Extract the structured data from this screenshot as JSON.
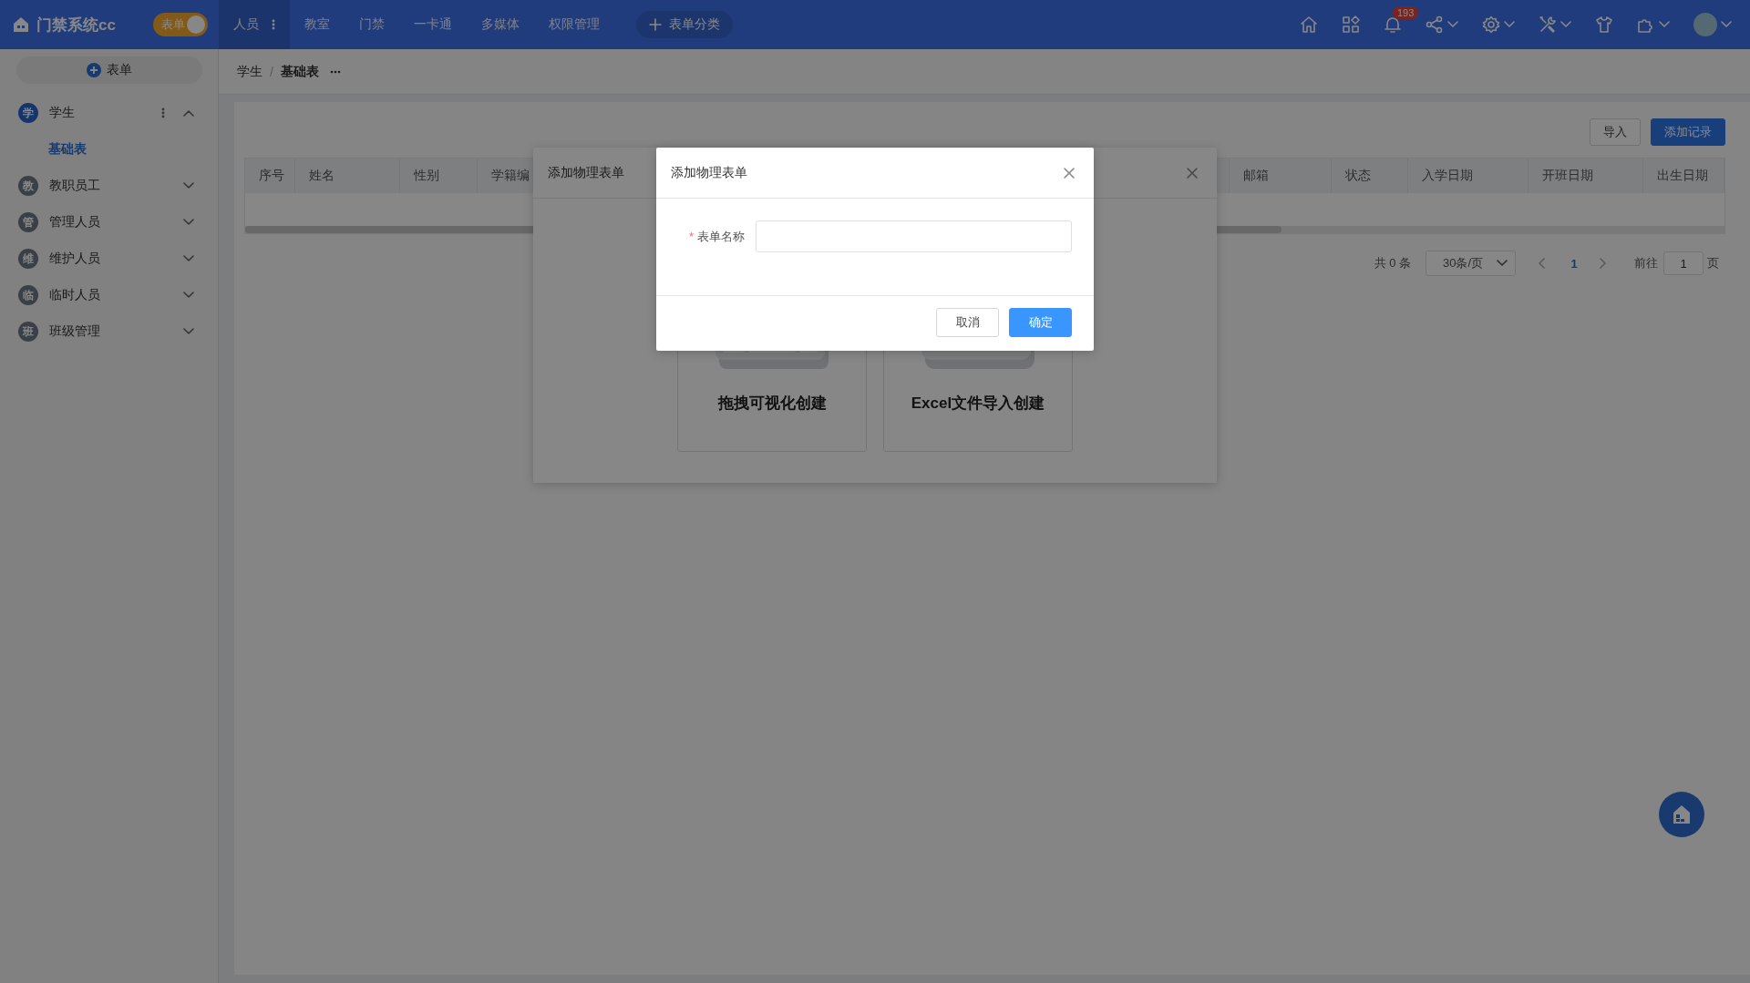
{
  "app": {
    "title": "门禁系统cc",
    "mode_switch": {
      "label": "表单",
      "on": true
    }
  },
  "nav": [
    {
      "label": "人员",
      "selected": true
    },
    {
      "label": "教室",
      "selected": false
    },
    {
      "label": "门禁",
      "selected": false
    },
    {
      "label": "一卡通",
      "selected": false
    },
    {
      "label": "多媒体",
      "selected": false
    },
    {
      "label": "权限管理",
      "selected": false
    }
  ],
  "add_category": {
    "label": "表单分类"
  },
  "notifications": {
    "count": "193"
  },
  "sidebar": {
    "add_button": "表单",
    "items": [
      {
        "badge": "学",
        "label": "学生",
        "selected": true,
        "expanded": true,
        "children": [
          {
            "label": "基础表",
            "selected": true
          }
        ]
      },
      {
        "badge": "教",
        "label": "教职员工",
        "selected": false,
        "expanded": false
      },
      {
        "badge": "管",
        "label": "管理人员",
        "selected": false,
        "expanded": false
      },
      {
        "badge": "维",
        "label": "维护人员",
        "selected": false,
        "expanded": false
      },
      {
        "badge": "临",
        "label": "临时人员",
        "selected": false,
        "expanded": false
      },
      {
        "badge": "班",
        "label": "班级管理",
        "selected": false,
        "expanded": false
      }
    ]
  },
  "breadcrumb": {
    "items": [
      "学生",
      "基础表"
    ],
    "separator": "/"
  },
  "toolbar": {
    "buttons": [
      {
        "label": "导入",
        "kind": "default"
      },
      {
        "label": "添加记录",
        "kind": "primary"
      }
    ]
  },
  "table": {
    "columns": [
      "序号",
      "姓名",
      "性别",
      "学籍编",
      "邮箱",
      "状态",
      "入学日期",
      "开班日期",
      "出生日期"
    ]
  },
  "pagination": {
    "total": "共 0 条",
    "page_size": "30条/页",
    "pages": [
      {
        "label": "1",
        "selected": true
      }
    ],
    "goto_label": "前往",
    "goto_value": "1",
    "page_suffix": "页"
  },
  "back_dialog": {
    "title": "添加物理表单",
    "options": [
      {
        "label": "拖拽可视化创建",
        "kind": "drag"
      },
      {
        "label": "Excel文件导入创建",
        "kind": "excel"
      }
    ]
  },
  "dialog": {
    "title": "添加物理表单",
    "fields": [
      {
        "label": "表单名称",
        "required": true,
        "required_mark": "*"
      }
    ],
    "buttons": [
      {
        "label": "取消",
        "kind": "default"
      },
      {
        "label": "确定",
        "kind": "primary"
      }
    ]
  }
}
